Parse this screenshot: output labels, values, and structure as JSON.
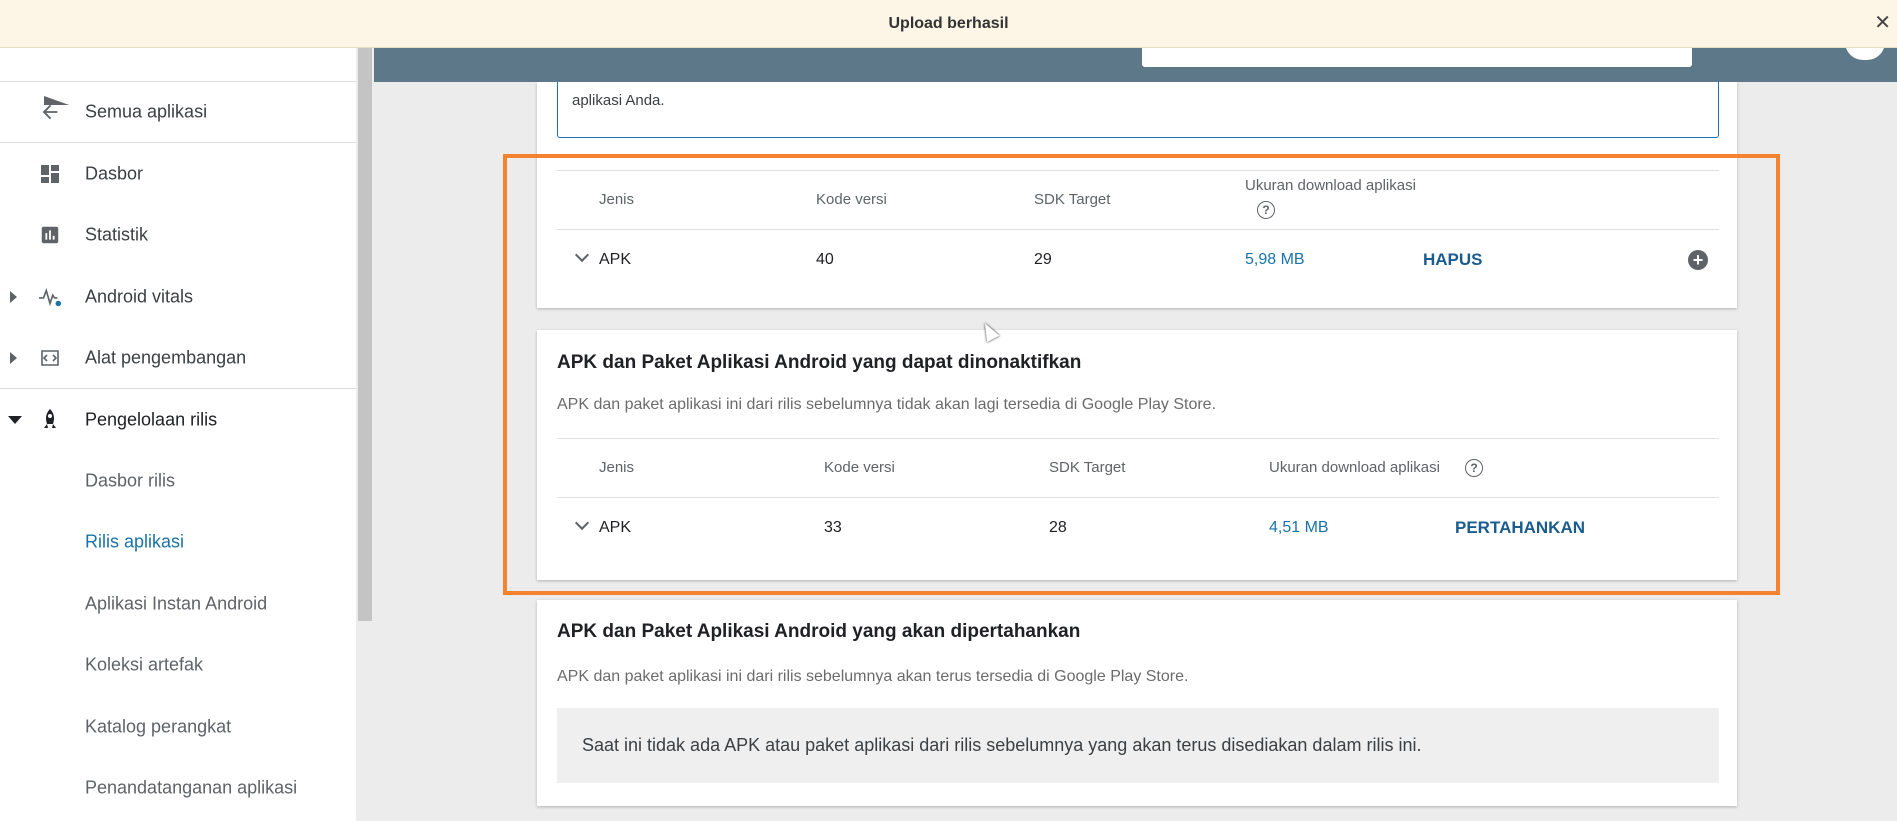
{
  "notification": {
    "text": "Upload berhasil",
    "close": "✕"
  },
  "sidebar": {
    "items": [
      {
        "label": "Semua aplikasi",
        "icon": "arrow-back-icon"
      },
      {
        "label": "Dasbor",
        "icon": "dashboard-icon"
      },
      {
        "label": "Statistik",
        "icon": "bar-chart-icon"
      },
      {
        "label": "Android vitals",
        "icon": "pulse-icon"
      },
      {
        "label": "Alat pengembangan",
        "icon": "code-icon"
      },
      {
        "label": "Pengelolaan rilis",
        "icon": "rocket-icon"
      },
      {
        "label": "Dasbor rilis"
      },
      {
        "label": "Rilis aplikasi"
      },
      {
        "label": "Aplikasi Instan Android"
      },
      {
        "label": "Koleksi artefak"
      },
      {
        "label": "Katalog perangkat"
      },
      {
        "label": "Penandatanganan aplikasi"
      }
    ]
  },
  "intro": {
    "text": "aplikasi Anda."
  },
  "added": {
    "headers": {
      "type": "Jenis",
      "version": "Kode versi",
      "sdk": "SDK Target",
      "size": "Ukuran download aplikasi"
    },
    "row": {
      "type": "APK",
      "version": "40",
      "sdk": "29",
      "size": "5,98 MB",
      "action": "HAPUS"
    }
  },
  "deactivated": {
    "title": "APK dan Paket Aplikasi Android yang dapat dinonaktifkan",
    "subtitle": "APK dan paket aplikasi ini dari rilis sebelumnya tidak akan lagi tersedia di Google Play Store.",
    "headers": {
      "type": "Jenis",
      "version": "Kode versi",
      "sdk": "SDK Target",
      "size": "Ukuran download aplikasi"
    },
    "row": {
      "type": "APK",
      "version": "33",
      "sdk": "28",
      "size": "4,51 MB",
      "action": "PERTAHANKAN"
    }
  },
  "retained": {
    "title": "APK dan Paket Aplikasi Android yang akan dipertahankan",
    "subtitle": "APK dan paket aplikasi ini dari rilis sebelumnya akan terus tersedia di Google Play Store.",
    "empty": "Saat ini tidak ada APK atau paket aplikasi dari rilis sebelumnya yang akan terus disediakan dalam rilis ini."
  },
  "colors": {
    "accent": "#1a73a8",
    "header": "#5c7889",
    "highlight": "#f5822f"
  }
}
